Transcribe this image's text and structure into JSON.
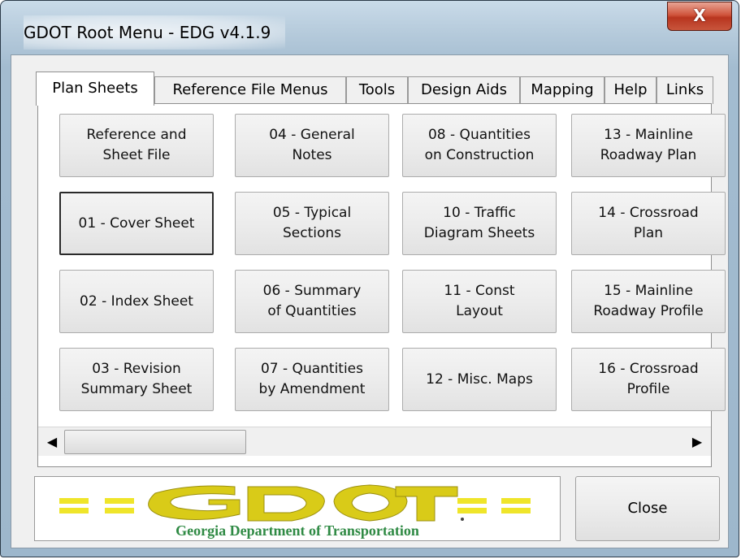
{
  "window": {
    "title": "GDOT Root Menu - EDG v4.1.9",
    "close_glyph": "X"
  },
  "tabs": [
    {
      "label": "Plan Sheets",
      "active": true
    },
    {
      "label": "Reference File Menus",
      "active": false
    },
    {
      "label": "Tools",
      "active": false
    },
    {
      "label": "Design Aids",
      "active": false
    },
    {
      "label": "Mapping",
      "active": false
    },
    {
      "label": "Help",
      "active": false
    },
    {
      "label": "Links",
      "active": false
    }
  ],
  "buttons": [
    [
      "Reference and\nSheet File",
      "04 - General\nNotes",
      "08 - Quantities\non Construction",
      "13 - Mainline\nRoadway Plan"
    ],
    [
      "01 - Cover Sheet",
      "05 - Typical\nSections",
      "10 - Traffic\nDiagram Sheets",
      "14 - Crossroad\nPlan"
    ],
    [
      "02 - Index Sheet",
      "06 - Summary\nof Quantities",
      "11 - Const\nLayout",
      "15 - Mainline\nRoadway Profile"
    ],
    [
      "03 - Revision\nSummary Sheet",
      "07 - Quantities\nby Amendment",
      "12 - Misc. Maps",
      "16 - Crossroad\nProfile"
    ]
  ],
  "scrollbar": {
    "left_arrow_icon": "scroll-left-icon",
    "right_arrow_icon": "scroll-right-icon",
    "left_glyph": "◀",
    "right_glyph": "▶",
    "position": 0
  },
  "logo": {
    "wordmark": "GDOT",
    "subtitle": "Georgia Department of Transportation",
    "colors": {
      "gold": "#ddd01a",
      "green": "#2f8a44",
      "road_line": "#efe52a"
    }
  },
  "close_button": {
    "label": "Close"
  }
}
